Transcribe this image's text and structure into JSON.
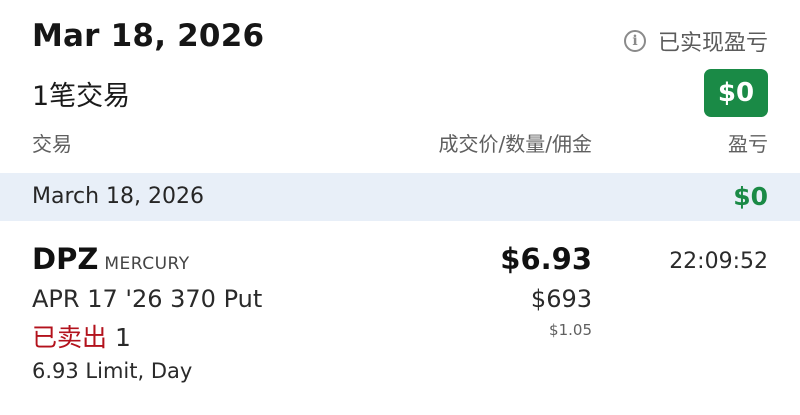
{
  "header": {
    "date": "Mar 18, 2026",
    "realized_pl_label": "已实现盈亏",
    "info_icon": "info-icon",
    "trade_count": "1笔交易",
    "total_pl": "$0"
  },
  "columns": {
    "trade": "交易",
    "price_qty_commission": "成交价/数量/佣金",
    "pl": "盈亏"
  },
  "group": {
    "date": "March 18, 2026",
    "pl": "$0"
  },
  "trade": {
    "symbol": "DPZ",
    "exchange": "MERCURY",
    "contract": "APR 17 '26 370 Put",
    "action": "已卖出",
    "quantity": "1",
    "order_type": "6.93 Limit, Day",
    "fill_price": "$6.93",
    "amount": "$693",
    "commission": "$1.05",
    "time": "22:09:52"
  },
  "colors": {
    "profit_green": "#1a8a46",
    "sold_red": "#b3121c",
    "band_bg": "#e8eff8"
  }
}
